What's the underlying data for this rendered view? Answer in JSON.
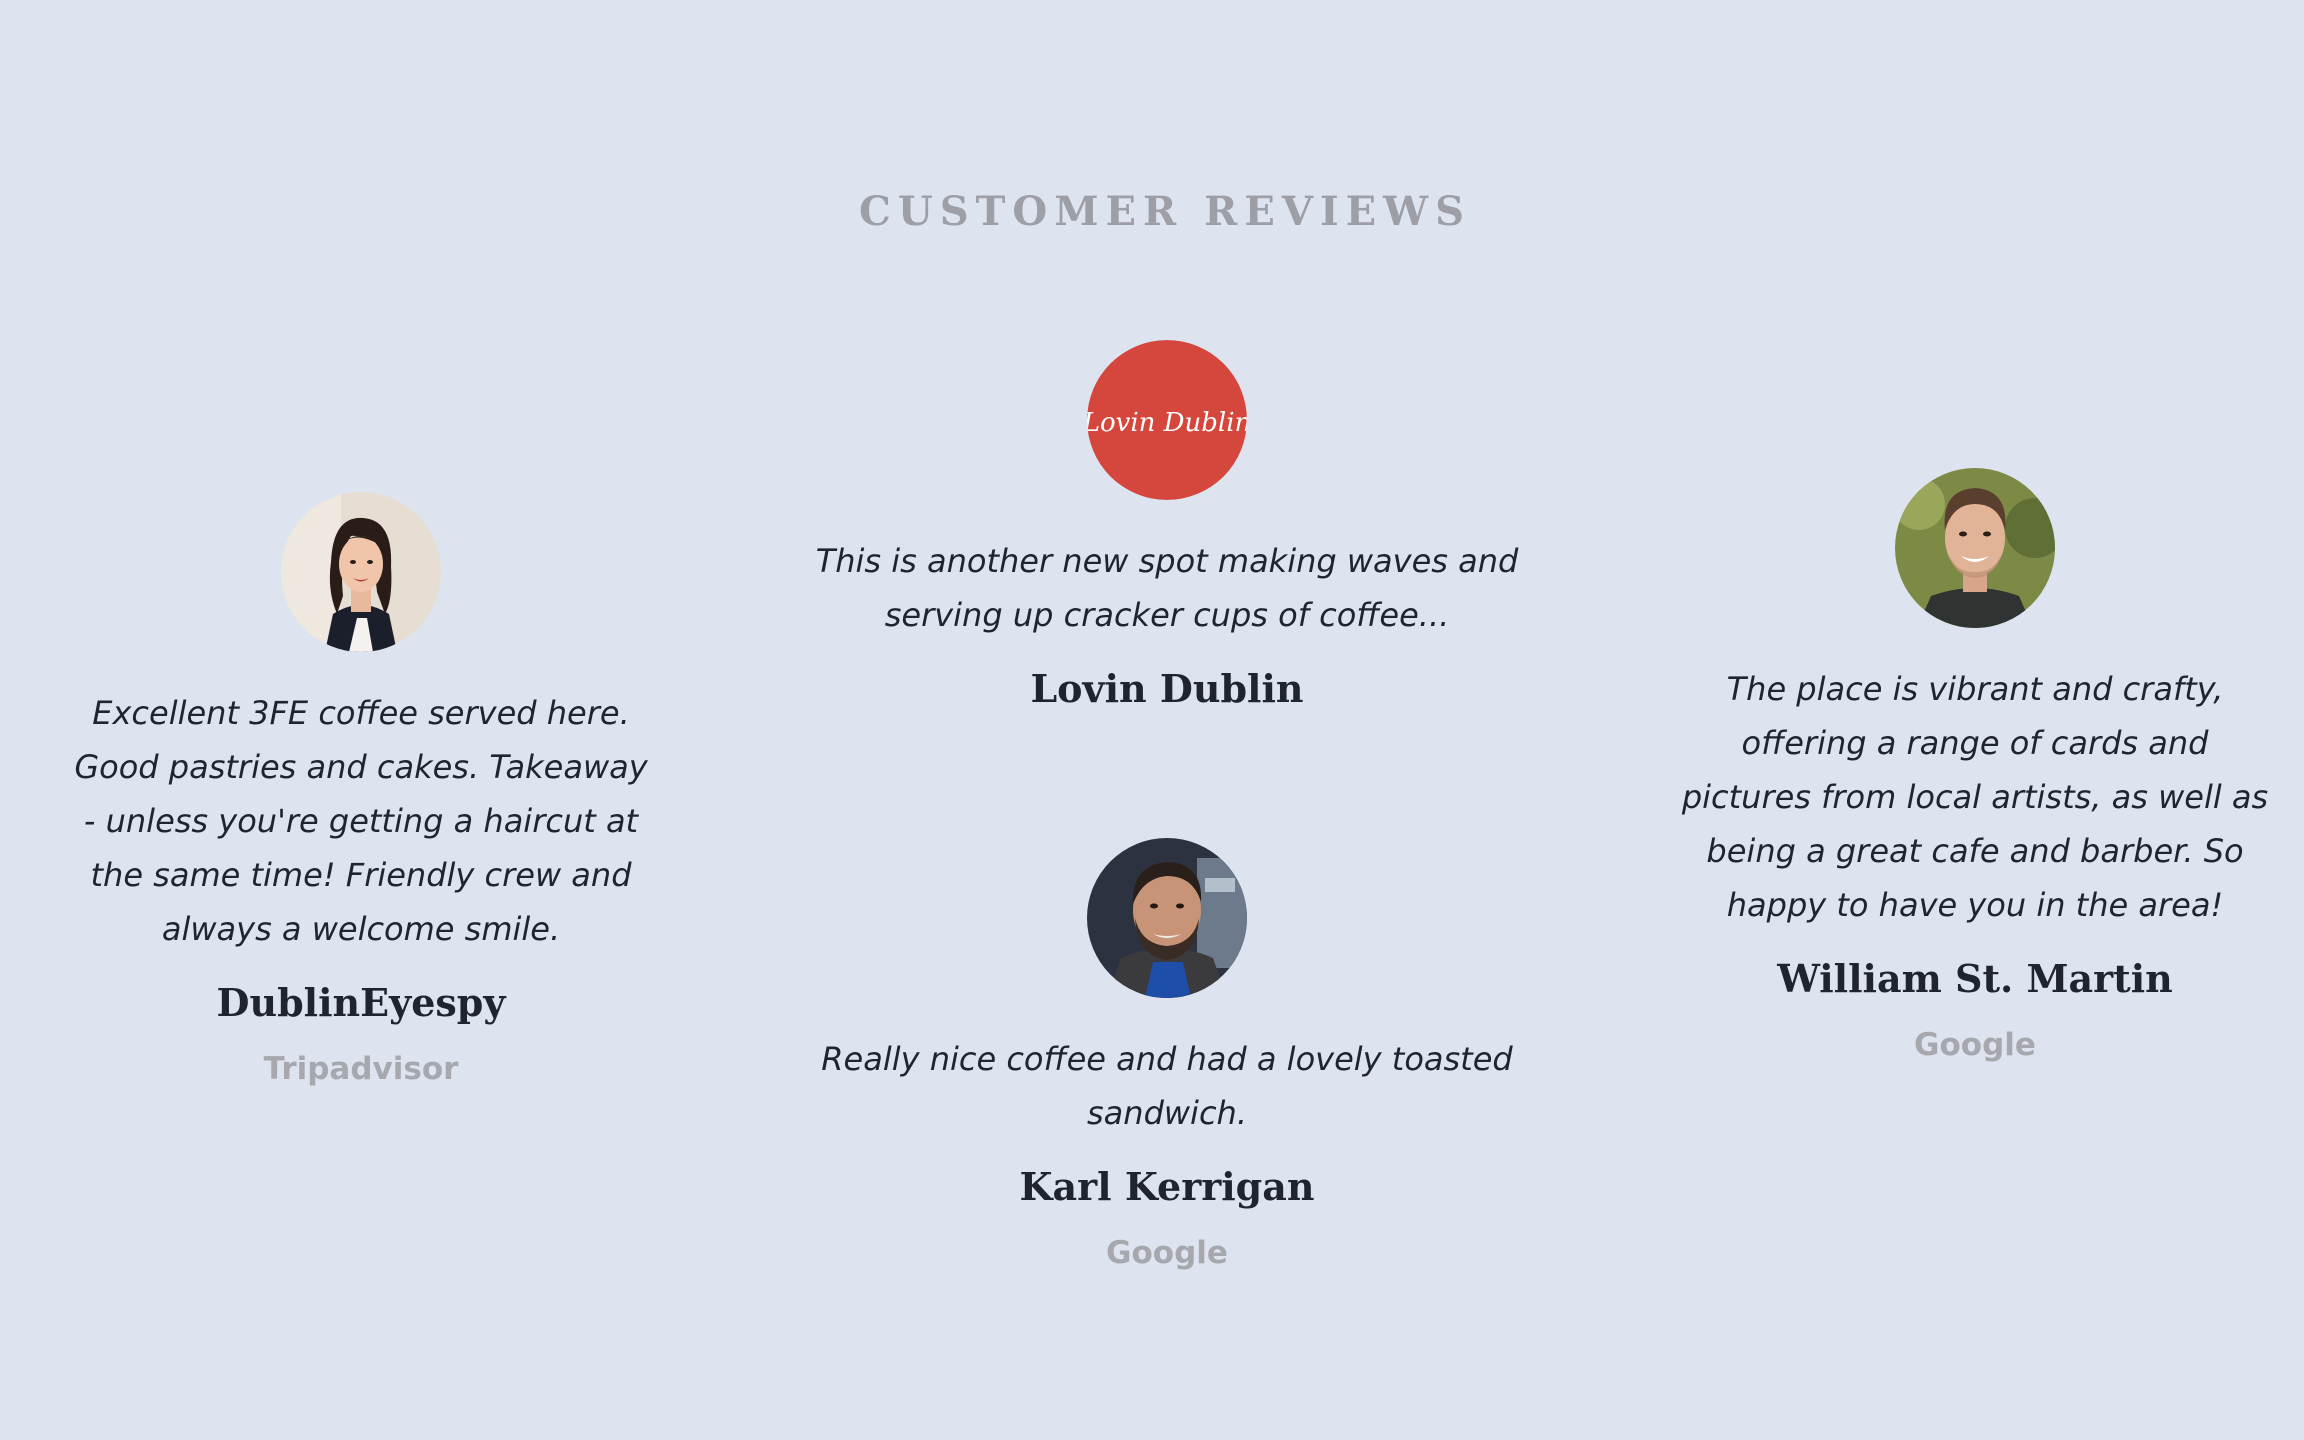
{
  "section": {
    "title": "CUSTOMER REVIEWS"
  },
  "reviews": [
    {
      "quote": "Excellent 3FE coffee served here. Good pastries and cakes. Takeaway - unless you're getting a haircut at the same time! Friendly crew and always a welcome smile.",
      "author": "DublinEyespy",
      "source": "Tripadvisor",
      "avatar": "woman-portrait-avatar"
    },
    {
      "quote": "This is another new spot making waves and serving up cracker cups of coffee...",
      "author": "Lovin Dublin",
      "source": "",
      "avatar": "lovin-dublin-logo",
      "logo_text": "Lovin Dublin",
      "logo_color": "#d5473c"
    },
    {
      "quote": "Really nice coffee and had a lovely toasted sandwich.",
      "author": "Karl Kerrigan",
      "source": "Google",
      "avatar": "man-bearded-portrait-avatar"
    },
    {
      "quote": "The place is vibrant and crafty, offering a range of cards and pictures from local artists, as well as being a great cafe and barber. So happy to have you in the area!",
      "author": "William St. Martin",
      "source": "Google",
      "avatar": "man-portrait-avatar"
    }
  ]
}
